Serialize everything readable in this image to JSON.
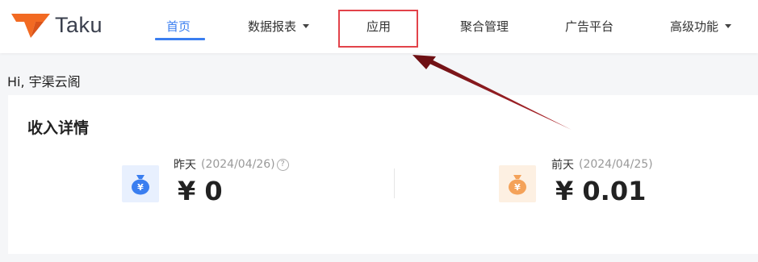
{
  "brand": {
    "name": "Taku",
    "accent": "#f26a22"
  },
  "nav": {
    "items": [
      {
        "label": "首页",
        "active": true,
        "dropdown": false
      },
      {
        "label": "数据报表",
        "active": false,
        "dropdown": true
      },
      {
        "label": "应用",
        "active": false,
        "dropdown": false
      },
      {
        "label": "聚合管理",
        "active": false,
        "dropdown": false
      },
      {
        "label": "广告平台",
        "active": false,
        "dropdown": false
      },
      {
        "label": "高级功能",
        "active": false,
        "dropdown": true
      }
    ],
    "active_color": "#3a7ef0"
  },
  "annotation": {
    "box_color": "#e2434a",
    "arrow_color": "#7a1418"
  },
  "greeting": "Hi, 宇渠云阁",
  "income": {
    "title": "收入详情",
    "metrics": [
      {
        "label": "昨天",
        "date": "(2024/04/26)",
        "value": "¥ 0",
        "icon": "money-bag-icon",
        "color": "#3a7ef0"
      },
      {
        "label": "前天",
        "date": "(2024/04/25)",
        "value": "¥ 0.01",
        "icon": "money-bag-icon",
        "color": "#f4a259"
      }
    ]
  }
}
